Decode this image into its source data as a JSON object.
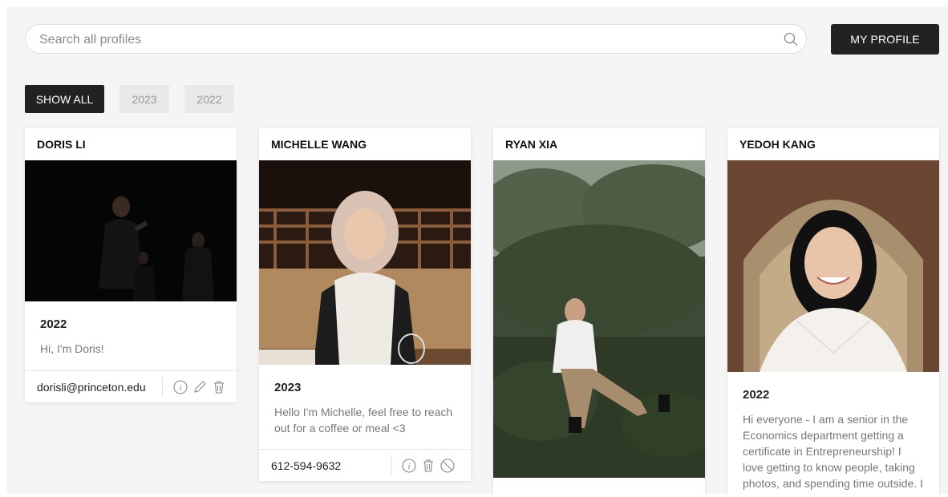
{
  "search": {
    "placeholder": "Search all profiles"
  },
  "header": {
    "my_profile_label": "MY PROFILE"
  },
  "filters": [
    {
      "label": "SHOW ALL",
      "active": true
    },
    {
      "label": "2023",
      "active": false
    },
    {
      "label": "2022",
      "active": false
    }
  ],
  "cards": [
    {
      "name": "DORIS LI",
      "year": "2022",
      "bio": "Hi, I'm Doris!",
      "contact": "dorisli@princeton.edu",
      "actions": [
        "info-icon",
        "pencil-icon",
        "trash-icon"
      ]
    },
    {
      "name": "MICHELLE WANG",
      "year": "2023",
      "bio": "Hello I'm Michelle, feel free to reach out for a coffee or meal <3",
      "contact": "612-594-9632",
      "actions": [
        "info-icon",
        "trash-icon",
        "block-icon"
      ]
    },
    {
      "name": "RYAN XIA"
    },
    {
      "name": "YEDOH KANG",
      "year": "2022",
      "bio": "Hi everyone - I am a senior in the Economics department getting a certificate in Entrepreneurship! I love getting to know people, taking photos, and spending time outside. I"
    }
  ],
  "colors": {
    "dark": "#222222",
    "inactive_bg": "#e9e9e9",
    "muted_text": "#777777"
  }
}
